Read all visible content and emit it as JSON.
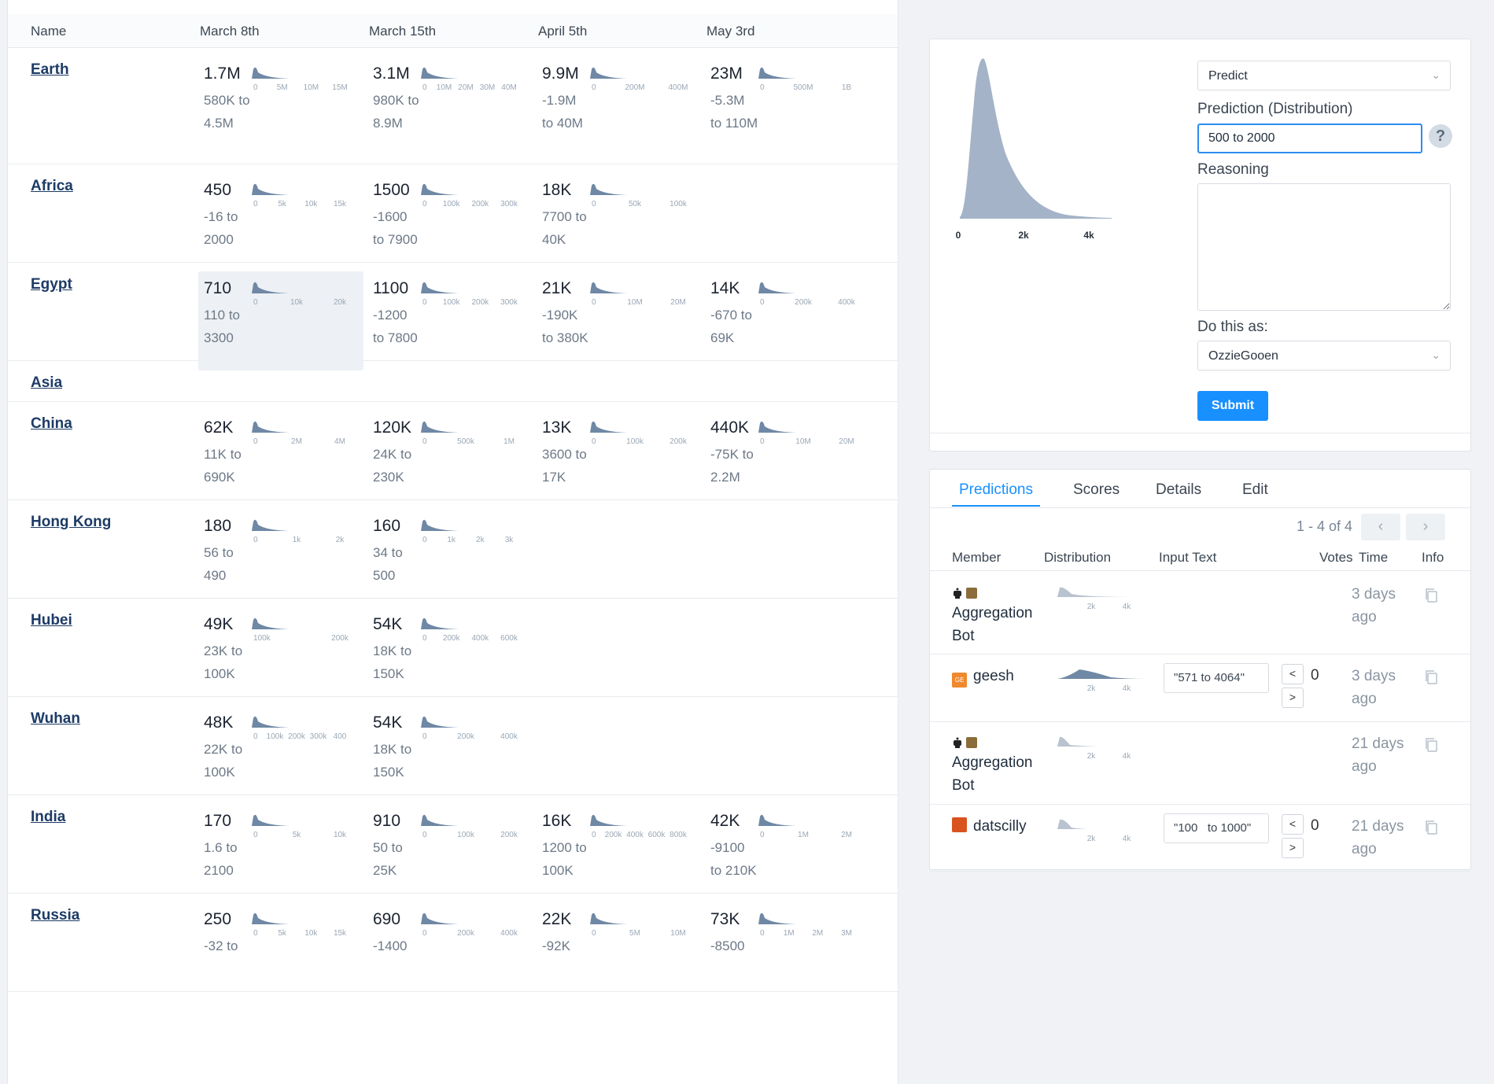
{
  "table": {
    "headers": [
      "Name",
      "March 8th",
      "March 15th",
      "April 5th",
      "May 3rd"
    ],
    "rows": [
      {
        "name": "Earth",
        "cells": [
          {
            "median": "1.7M",
            "range": "580K to 4.5M",
            "ticks": [
              "0",
              "5M",
              "10M",
              "15M"
            ]
          },
          {
            "median": "3.1M",
            "range": "980K to 8.9M",
            "ticks": [
              "0",
              "10M",
              "20M",
              "30M",
              "40M"
            ]
          },
          {
            "median": "9.9M",
            "range": "-1.9M to 40M",
            "ticks": [
              "0",
              "200M",
              "400M"
            ]
          },
          {
            "median": "23M",
            "range": "-5.3M to 110M",
            "ticks": [
              "0",
              "500M",
              "1B"
            ]
          }
        ]
      },
      {
        "name": "Africa",
        "cells": [
          {
            "median": "450",
            "range": "-16 to 2000",
            "ticks": [
              "0",
              "5k",
              "10k",
              "15k"
            ]
          },
          {
            "median": "1500",
            "range": "-1600 to 7900",
            "ticks": [
              "0",
              "100k",
              "200k",
              "300k"
            ]
          },
          {
            "median": "18K",
            "range": "7700 to 40K",
            "ticks": [
              "0",
              "50k",
              "100k"
            ]
          }
        ]
      },
      {
        "name": "Egypt",
        "cells": [
          {
            "median": "710",
            "range": "110 to 3300",
            "ticks": [
              "0",
              "10k",
              "20k"
            ]
          },
          {
            "median": "1100",
            "range": "-1200 to 7800",
            "ticks": [
              "0",
              "100k",
              "200k",
              "300k"
            ]
          },
          {
            "median": "21K",
            "range": "-190K to 380K",
            "ticks": [
              "0",
              "10M",
              "20M"
            ]
          },
          {
            "median": "14K",
            "range": "-670 to 69K",
            "ticks": [
              "0",
              "200k",
              "400k"
            ]
          }
        ]
      },
      {
        "name": "Asia",
        "cells": []
      },
      {
        "name": "China",
        "cells": [
          {
            "median": "62K",
            "range": "11K to 690K",
            "ticks": [
              "0",
              "2M",
              "4M"
            ]
          },
          {
            "median": "120K",
            "range": "24K to 230K",
            "ticks": [
              "0",
              "500k",
              "1M"
            ]
          },
          {
            "median": "13K",
            "range": "3600 to 17K",
            "ticks": [
              "0",
              "100k",
              "200k"
            ]
          },
          {
            "median": "440K",
            "range": "-75K to 2.2M",
            "ticks": [
              "0",
              "10M",
              "20M"
            ]
          }
        ]
      },
      {
        "name": "Hong Kong",
        "cells": [
          {
            "median": "180",
            "range": "56 to 490",
            "ticks": [
              "0",
              "1k",
              "2k"
            ]
          },
          {
            "median": "160",
            "range": "34 to 500",
            "ticks": [
              "0",
              "1k",
              "2k",
              "3k"
            ]
          }
        ]
      },
      {
        "name": "Hubei",
        "cells": [
          {
            "median": "49K",
            "range": "23K to 100K",
            "ticks": [
              "100k",
              "200k"
            ]
          },
          {
            "median": "54K",
            "range": "18K to 150K",
            "ticks": [
              "0",
              "200k",
              "400k",
              "600k"
            ]
          }
        ]
      },
      {
        "name": "Wuhan",
        "cells": [
          {
            "median": "48K",
            "range": "22K to 100K",
            "ticks": [
              "0",
              "100k",
              "200k",
              "300k",
              "400"
            ]
          },
          {
            "median": "54K",
            "range": "18K to 150K",
            "ticks": [
              "0",
              "200k",
              "400k"
            ]
          }
        ]
      },
      {
        "name": "India",
        "cells": [
          {
            "median": "170",
            "range": "1.6 to 2100",
            "ticks": [
              "0",
              "5k",
              "10k"
            ]
          },
          {
            "median": "910",
            "range": "50 to 25K",
            "ticks": [
              "0",
              "100k",
              "200k"
            ]
          },
          {
            "median": "16K",
            "range": "1200 to 100K",
            "ticks": [
              "0",
              "200k",
              "400k",
              "600k",
              "800k"
            ]
          },
          {
            "median": "42K",
            "range": "-9100 to 210K",
            "ticks": [
              "0",
              "1M",
              "2M"
            ]
          }
        ]
      },
      {
        "name": "Russia",
        "cells": [
          {
            "median": "250",
            "range": "-32 to",
            "ticks": [
              "0",
              "5k",
              "10k",
              "15k"
            ]
          },
          {
            "median": "690",
            "range": "-1400",
            "ticks": [
              "0",
              "200k",
              "400k"
            ]
          },
          {
            "median": "22K",
            "range": "-92K",
            "ticks": [
              "0",
              "5M",
              "10M"
            ]
          },
          {
            "median": "73K",
            "range": "-8500",
            "ticks": [
              "0",
              "1M",
              "2M",
              "3M"
            ]
          }
        ]
      }
    ]
  },
  "form": {
    "type_select": "Predict",
    "prediction_label": "Prediction (Distribution)",
    "prediction_value": "500 to 2000",
    "help_glyph": "?",
    "reasoning_label": "Reasoning",
    "reasoning_value": "",
    "do_as_label": "Do this as:",
    "do_as_value": "OzzieGooen",
    "submit_label": "Submit",
    "dist_ticks": [
      "0",
      "2k",
      "4k"
    ]
  },
  "predictions": {
    "tabs": [
      "Predictions",
      "Scores",
      "Details",
      "Edit"
    ],
    "active_tab": "Predictions",
    "pagination": "1 - 4 of 4",
    "prev_glyph": "‹",
    "next_glyph": "›",
    "columns": [
      "Member",
      "Distribution",
      "Input Text",
      "Votes",
      "Time",
      "Info"
    ],
    "rows": [
      {
        "member": "Aggregation Bot",
        "bot": true,
        "input_text": "",
        "votes": "",
        "time": "3 days ago",
        "ticks": [
          "2k",
          "4k"
        ]
      },
      {
        "member": "geesh",
        "bot": false,
        "avatar_text": "GE",
        "avatar_color": "#f0892e",
        "input_text": "\"571 to 4064\"",
        "votes": "0",
        "time": "3 days ago",
        "ticks": [
          "2k",
          "4k"
        ]
      },
      {
        "member": "Aggregation Bot",
        "bot": true,
        "input_text": "",
        "votes": "",
        "time": "21 days ago",
        "ticks": [
          "2k",
          "4k"
        ]
      },
      {
        "member": "datscilly",
        "bot": false,
        "avatar_text": "",
        "avatar_color": "#d9531e",
        "input_text": "\"100   to 1000\"",
        "votes": "0",
        "time": "21 days ago",
        "ticks": [
          "2k",
          "4k"
        ]
      }
    ]
  },
  "colors": {
    "accent": "#1890ff",
    "dist_fill": "#a4b3c7",
    "spark_fill": "#6f88a5",
    "link": "#1d3b66"
  }
}
